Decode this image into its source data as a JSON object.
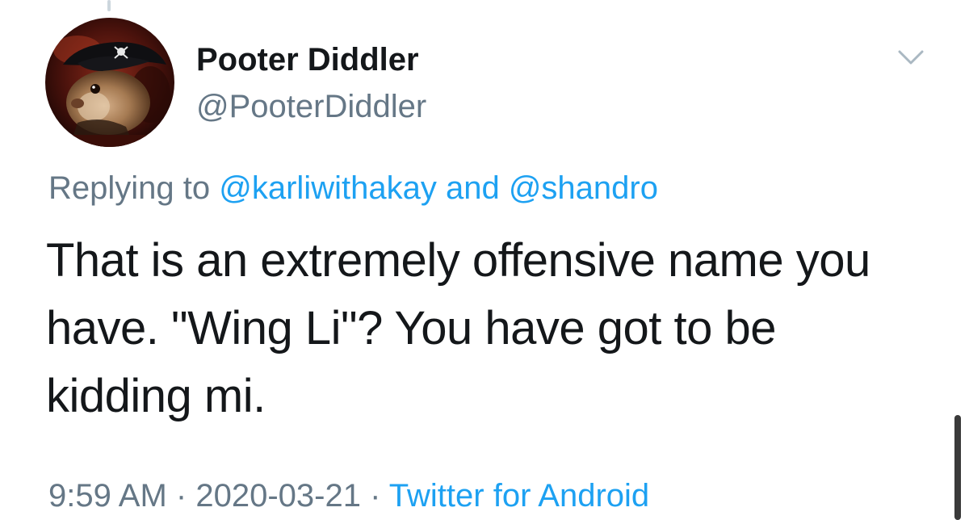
{
  "tweet": {
    "author": {
      "display_name": "Pooter Diddler",
      "handle": "@PooterDiddler",
      "avatar_icon": "guinea-pig-pirate-avatar"
    },
    "reply_prefix": "Replying to",
    "reply_mention_1": "@karliwithakay",
    "reply_conjunction": "and",
    "reply_mention_2": "@shandro",
    "text": "That is an extremely offensive name you have. \"Wing Li\"? You have got to be kidding mi.",
    "time": "9:59 AM",
    "separator": "·",
    "date": "2020-03-21",
    "source": "Twitter for Android",
    "menu_icon": "chevron-down-icon"
  },
  "colors": {
    "link": "#1da1f2",
    "secondary_text": "#657786",
    "primary_text": "#14171a"
  }
}
